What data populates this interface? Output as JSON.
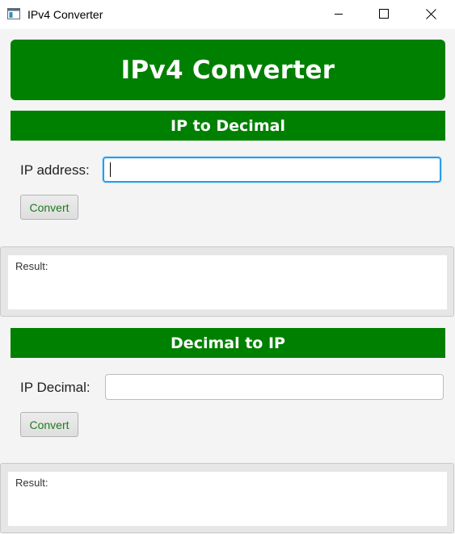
{
  "window": {
    "title": "IPv4 Converter",
    "icon": "app-window-icon",
    "controls": [
      "minimize-icon",
      "maximize-icon",
      "close-icon"
    ]
  },
  "header": {
    "title": "IPv4 Converter"
  },
  "ip_to_decimal": {
    "section_title": "IP to Decimal",
    "field_label": "IP address:",
    "input_value": "",
    "convert_label": "Convert",
    "result_text": "Result:"
  },
  "decimal_to_ip": {
    "section_title": "Decimal to IP",
    "field_label": "IP Decimal:",
    "input_value": "",
    "convert_label": "Convert",
    "result_text": "Result:"
  },
  "colors": {
    "accent": "#008000",
    "button_text": "#1f7a1f",
    "focus_border": "#2a9ee8",
    "background": "#f4f4f4"
  }
}
